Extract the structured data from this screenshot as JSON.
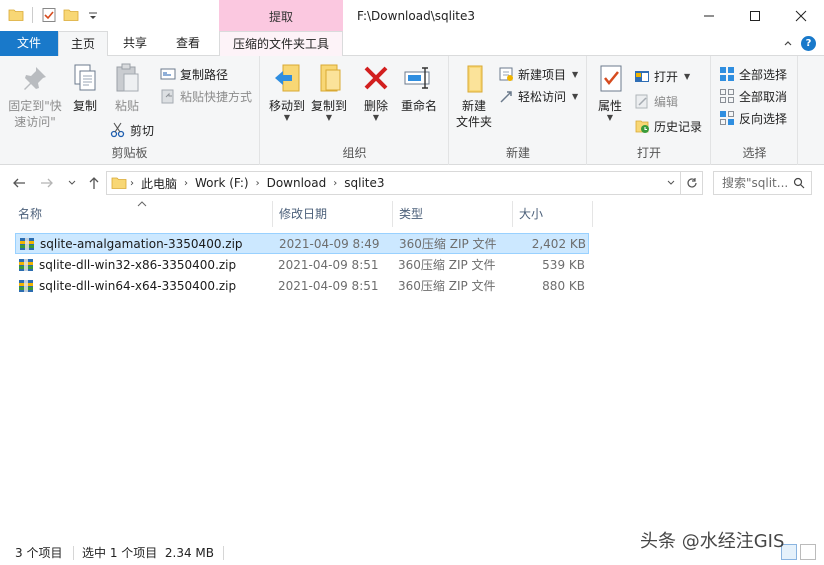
{
  "title_bar": {
    "context_tab_title": "提取",
    "window_title": "F:\\Download\\sqlite3"
  },
  "tabs": {
    "file": "文件",
    "home": "主页",
    "share": "共享",
    "view": "查看",
    "context": "压缩的文件夹工具"
  },
  "ribbon": {
    "clipboard": {
      "label": "剪贴板",
      "pin_line1": "固定到\"快",
      "pin_line2": "速访问\"",
      "copy": "复制",
      "paste": "粘贴",
      "copy_path": "复制路径",
      "paste_shortcut": "粘贴快捷方式",
      "cut": "剪切"
    },
    "organize": {
      "label": "组织",
      "move_to": "移动到",
      "copy_to": "复制到",
      "delete": "删除",
      "rename": "重命名"
    },
    "new": {
      "label": "新建",
      "new_folder_line1": "新建",
      "new_folder_line2": "文件夹",
      "new_item": "新建项目",
      "easy_access": "轻松访问"
    },
    "open": {
      "label": "打开",
      "properties": "属性",
      "open": "打开",
      "edit": "编辑",
      "history": "历史记录"
    },
    "select": {
      "label": "选择",
      "select_all": "全部选择",
      "select_none": "全部取消",
      "invert": "反向选择"
    }
  },
  "address_bar": {
    "crumbs": [
      "此电脑",
      "Work (F:)",
      "Download",
      "sqlite3"
    ],
    "search_placeholder": "搜索\"sqlit..."
  },
  "columns": {
    "name": "名称",
    "date": "修改日期",
    "type": "类型",
    "size": "大小"
  },
  "files": [
    {
      "name": "sqlite-amalgamation-3350400.zip",
      "date": "2021-04-09 8:49",
      "type": "360压缩 ZIP 文件",
      "size": "2,402 KB",
      "selected": true
    },
    {
      "name": "sqlite-dll-win32-x86-3350400.zip",
      "date": "2021-04-09 8:51",
      "type": "360压缩 ZIP 文件",
      "size": "539 KB",
      "selected": false
    },
    {
      "name": "sqlite-dll-win64-x64-3350400.zip",
      "date": "2021-04-09 8:51",
      "type": "360压缩 ZIP 文件",
      "size": "880 KB",
      "selected": false
    }
  ],
  "status": {
    "item_count": "3 个项目",
    "selection": "选中 1 个项目  2.34 MB"
  },
  "watermark": "头条 @水经注GIS",
  "colors": {
    "accent": "#1979ca",
    "context_tab": "#fbc8e0",
    "selection": "#cce8ff",
    "delete_red": "#d21f1f"
  }
}
